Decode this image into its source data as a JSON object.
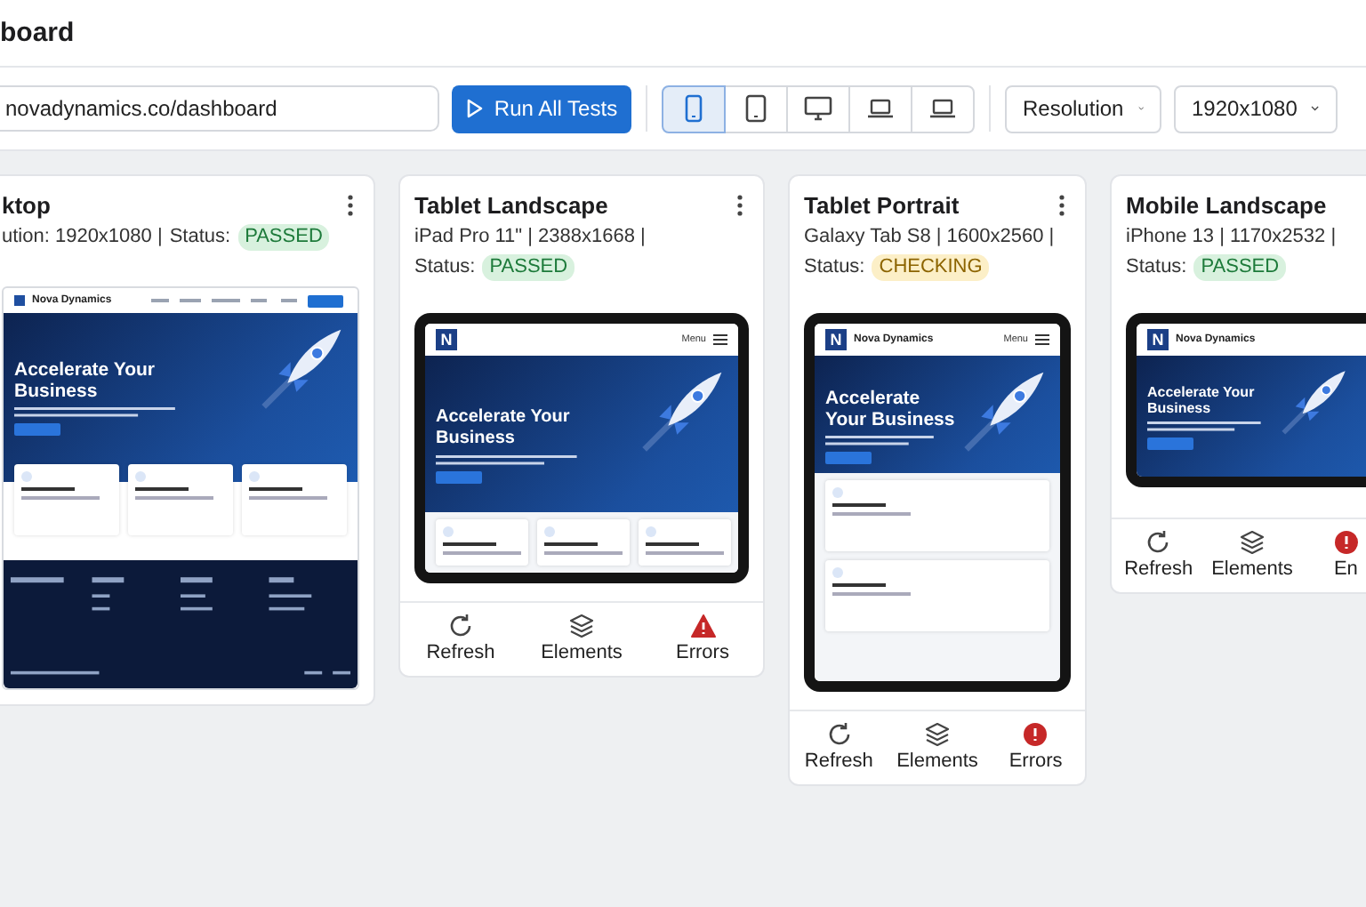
{
  "page_title": "board",
  "toolbar": {
    "url": "novadynamics.co/dashboard",
    "run_button": "Run All Tests",
    "devices": [
      {
        "kind": "phone",
        "selected": true
      },
      {
        "kind": "tablet",
        "selected": false
      },
      {
        "kind": "monitor",
        "selected": false
      },
      {
        "kind": "laptop",
        "selected": false
      },
      {
        "kind": "laptop",
        "selected": false
      }
    ],
    "dropdowns": [
      "Resolution",
      "1920x1080"
    ]
  },
  "cards": [
    {
      "title": "ktop",
      "spec": "ution: 1920x1080 |",
      "status_label": "Status:",
      "status": {
        "text": "PASSED",
        "kind": "passed"
      },
      "preview": {
        "kind": "desktop",
        "brand": "Nova Dynamics",
        "headline": "Accelerate Your Business"
      }
    },
    {
      "title": "Tablet Landscape",
      "spec": "iPad Pro 11\" | 2388x1668 |",
      "status_label": "Status:",
      "status": {
        "text": "PASSED",
        "kind": "passed"
      },
      "preview": {
        "kind": "tablet-landscape",
        "logo": "N",
        "menu": "Menu",
        "headline": "Accelerate Your Business"
      },
      "actions": [
        {
          "label": "Refresh",
          "kind": "refresh"
        },
        {
          "label": "Elements",
          "kind": "layers"
        },
        {
          "label": "Errors",
          "kind": "warning"
        }
      ]
    },
    {
      "title": "Tablet Portrait",
      "spec": "Galaxy Tab S8 | 1600x2560 |",
      "status_label": "Status:",
      "status": {
        "text": "CHECKING",
        "kind": "checking"
      },
      "preview": {
        "kind": "tablet-portrait",
        "logo": "N",
        "brand": "Nova Dynamics",
        "menu": "Menu",
        "headline": "Accelerate Your Business"
      },
      "actions": [
        {
          "label": "Refresh",
          "kind": "refresh"
        },
        {
          "label": "Elements",
          "kind": "layers"
        },
        {
          "label": "Errors",
          "kind": "alert"
        }
      ]
    },
    {
      "title": "Mobile Landscape",
      "spec": "iPhone 13 | 1170x2532 |",
      "status_label": "Status:",
      "status": {
        "text": "PASSED",
        "kind": "passed"
      },
      "preview": {
        "kind": "mobile-landscape",
        "logo": "N",
        "brand": "Nova Dynamics",
        "headline": "Accelerate Your Business"
      },
      "actions": [
        {
          "label": "Refresh",
          "kind": "refresh"
        },
        {
          "label": "Elements",
          "kind": "layers"
        },
        {
          "label": "En",
          "kind": "alert"
        }
      ]
    }
  ]
}
